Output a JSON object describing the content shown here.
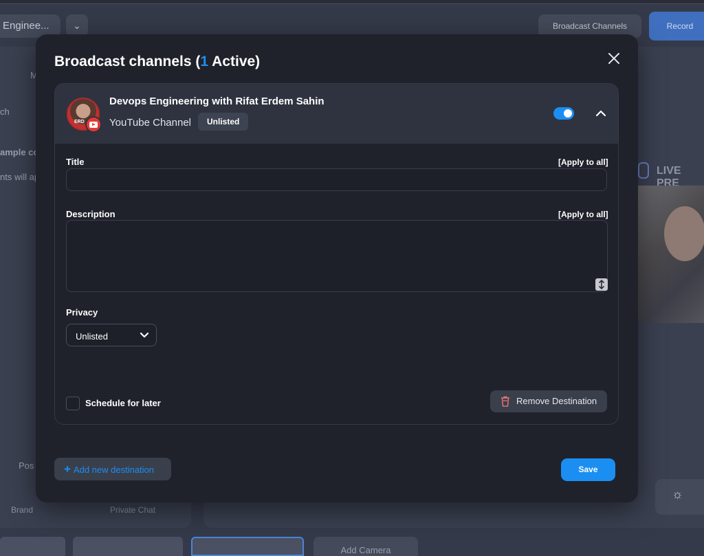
{
  "background": {
    "studio_name": "Enginee...",
    "broadcast_channels_label": "Broadcast Channels",
    "record_label": "Record",
    "live_preview_label": "LIVE PRE",
    "left_panel_fragments": [
      "M",
      "ch",
      "ample co",
      "nts will ap",
      "Pos"
    ],
    "bottom_labels": {
      "brand": "Brand",
      "private_chat": "Private Chat",
      "add_camera": "Add Camera"
    }
  },
  "modal": {
    "title_prefix": "Broadcast channels (",
    "active_count": "1",
    "title_suffix": " Active)",
    "channel": {
      "name": "Devops Engineering with Rifat Erdem Sahin",
      "type": "YouTube Channel",
      "privacy_badge": "Unlisted",
      "avatar_text": "ERD",
      "enabled": true
    },
    "form": {
      "title_label": "Title",
      "title_value": "",
      "description_label": "Description",
      "description_value": "",
      "apply_to_all": "[Apply to all]",
      "privacy_label": "Privacy",
      "privacy_selected": "Unlisted",
      "schedule_label": "Schedule for later",
      "schedule_checked": false,
      "remove_label": "Remove Destination"
    },
    "footer": {
      "add_destination": "Add new destination",
      "save": "Save"
    }
  },
  "colors": {
    "accent": "#1b8ef2",
    "modal_bg": "#1f222b",
    "card_header_bg": "#2e333f",
    "danger_icon": "#e57373",
    "youtube_red": "#e53935"
  }
}
